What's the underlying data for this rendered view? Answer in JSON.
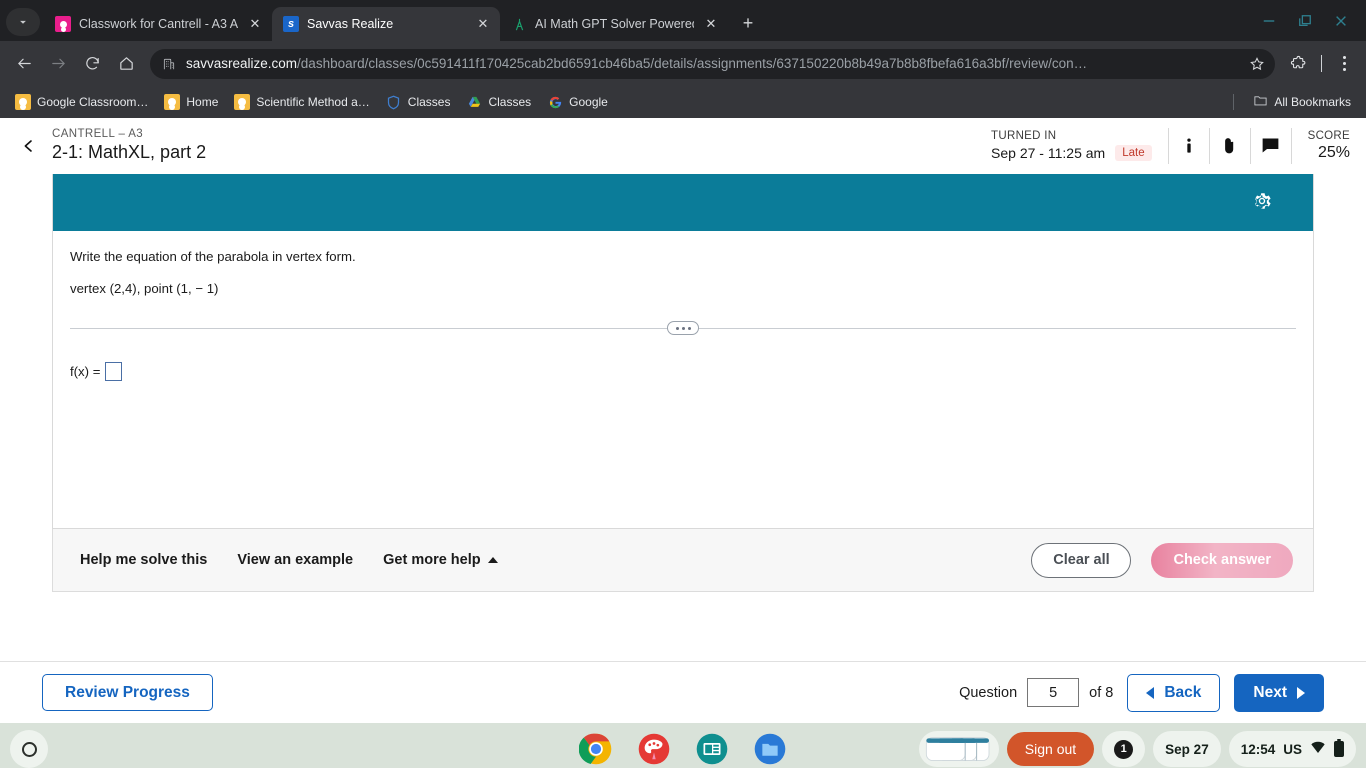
{
  "browser": {
    "tabs": [
      {
        "title": "Classwork for Cantrell - A3 A3",
        "favicon": "classroom-icon",
        "active": false,
        "close": "✕"
      },
      {
        "title": "Savvas Realize",
        "favicon": "savvas-icon",
        "active": true,
        "close": "✕"
      },
      {
        "title": "AI Math GPT Solver Powered by",
        "favicon": "compass-icon",
        "active": false,
        "close": "✕"
      }
    ],
    "new_tab_label": "+",
    "omnibox": {
      "domain": "savvasrealize.com",
      "path": "/dashboard/classes/0c591411f170425cab2bd6591cb46ba5/details/assignments/637150220b8b49a7b8b8fbefa616a3bf/review/con…"
    },
    "bookmarks": [
      {
        "label": "Google Classroom…",
        "icon": "google-classroom-icon"
      },
      {
        "label": "Home",
        "icon": "google-classroom-icon"
      },
      {
        "label": "Scientific Method a…",
        "icon": "google-classroom-icon"
      },
      {
        "label": "Classes",
        "icon": "shield-icon"
      },
      {
        "label": "Classes",
        "icon": "google-drive-icon"
      },
      {
        "label": "Google",
        "icon": "google-g-icon"
      }
    ],
    "all_bookmarks_label": "All Bookmarks"
  },
  "app_header": {
    "class_name": "CANTRELL – A3",
    "assignment_title": "2-1: MathXL, part 2",
    "turned_in_label": "TURNED IN",
    "turned_in_date": "Sep 27 - 11:25 am",
    "late_badge": "Late",
    "score_label": "SCORE",
    "score_value": "25%"
  },
  "exercise": {
    "header_color": "#0b7c99",
    "question_prompt": "Write the equation of the parabola in vertex form.",
    "question_given": "vertex (2,4), point (1, − 1)",
    "answer_label": "f(x) =",
    "answer_value": ""
  },
  "help_bar": {
    "help_me_solve": "Help me solve this",
    "view_example": "View an example",
    "get_more_help": "Get more help",
    "clear_all": "Clear all",
    "check_answer": "Check answer"
  },
  "bottom_nav": {
    "review_progress": "Review Progress",
    "question_label": "Question",
    "question_number": "5",
    "question_of": "of 8",
    "back": "Back",
    "next": "Next"
  },
  "shelf": {
    "apps": [
      {
        "name": "chrome-app-icon",
        "running": true
      },
      {
        "name": "canvas-app-icon",
        "running": false
      },
      {
        "name": "slides-app-icon",
        "running": false
      },
      {
        "name": "files-app-icon",
        "running": false
      }
    ],
    "sign_out": "Sign out",
    "notification_count": "1",
    "date": "Sep 27",
    "time": "12:54",
    "locale": "US"
  }
}
